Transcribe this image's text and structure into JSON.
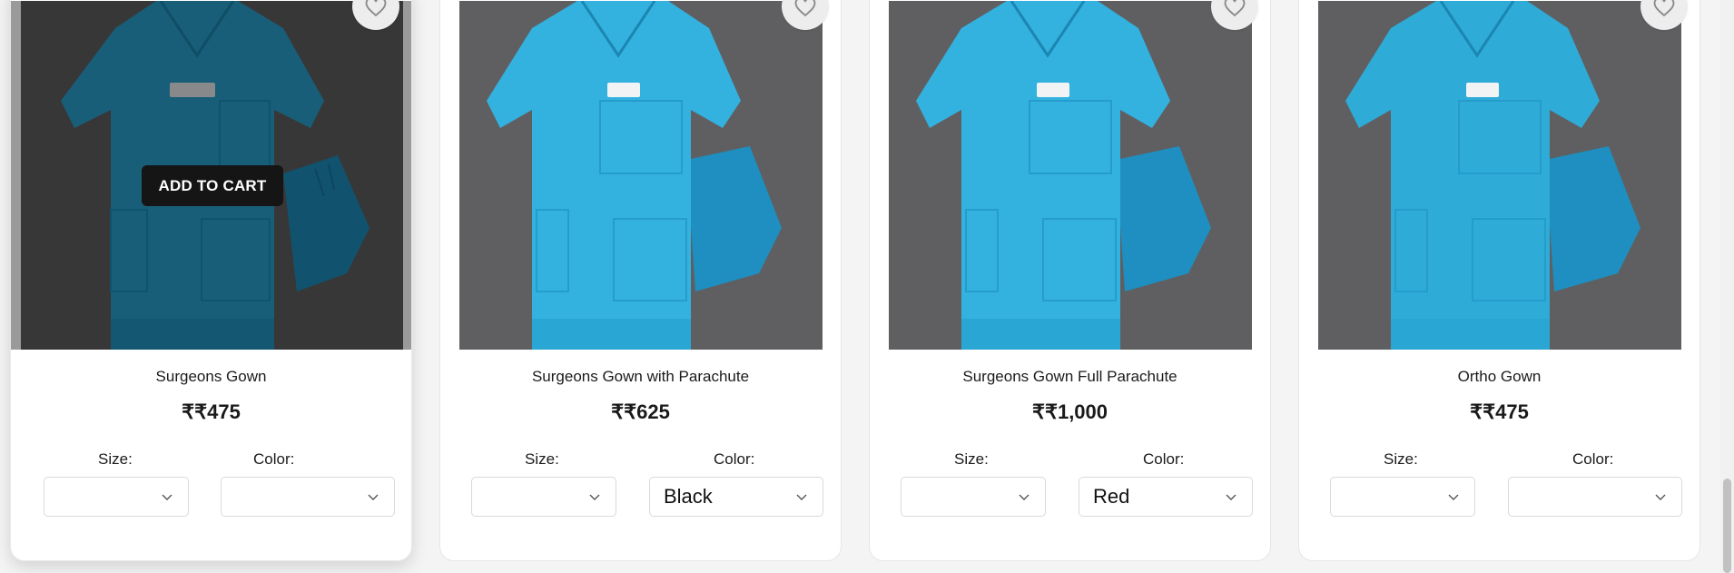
{
  "products": [
    {
      "title": "Surgeons Gown",
      "price": "₹₹475",
      "size_label": "Size:",
      "color_label": "Color:",
      "size_value": "",
      "color_value": "",
      "add_to_cart_label": "ADD TO CART"
    },
    {
      "title": "Surgeons Gown with Parachute",
      "price": "₹₹625",
      "size_label": "Size:",
      "color_label": "Color:",
      "size_value": "",
      "color_value": "Black"
    },
    {
      "title": "Surgeons Gown Full Parachute",
      "price": "₹₹1,000",
      "size_label": "Size:",
      "color_label": "Color:",
      "size_value": "",
      "color_value": "Red"
    },
    {
      "title": "Ortho Gown",
      "price": "₹₹475",
      "size_label": "Size:",
      "color_label": "Color:",
      "size_value": "",
      "color_value": ""
    }
  ],
  "icons": {
    "wishlist": "heart-outline-icon",
    "dropdown": "chevron-down-icon"
  },
  "colors": {
    "scrub": "#2aa3cf",
    "backdrop": "#5f5f61",
    "button": "#151515"
  }
}
